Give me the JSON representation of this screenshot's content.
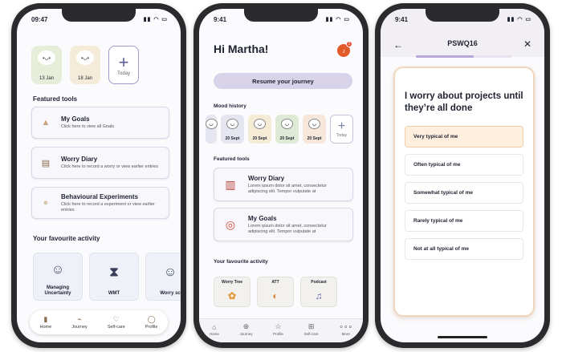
{
  "phone1": {
    "status": {
      "time": "09:47",
      "signal": "▮▮ ◠ ▭"
    },
    "moods": [
      {
        "date": "13 Jan",
        "color": "#e6edd9"
      },
      {
        "date": "18 Jan",
        "color": "#f4ecd8"
      }
    ],
    "today_label": "Today",
    "featured_title": "Featured tools",
    "tools": [
      {
        "title": "My Goals",
        "desc": "Click here to view all Goals",
        "icon": "mountain-icon",
        "glyph": "▲"
      },
      {
        "title": "Worry Diary",
        "desc": "Click here to record a worry or view earlier entries",
        "icon": "diary-icon",
        "glyph": "▤"
      },
      {
        "title": "Behavioural Experiments",
        "desc": "Click here to record a experiment or view earlier entries",
        "icon": "rock-icon",
        "glyph": "●"
      }
    ],
    "fav_title": "Your favourite activity",
    "activities": [
      {
        "label": "Managing Uncertainty",
        "glyph": "☺"
      },
      {
        "label": "WMT",
        "glyph": "⧗"
      },
      {
        "label": "Worry sc",
        "glyph": "☺"
      }
    ],
    "nav": [
      {
        "label": "Home",
        "icon": "home-icon",
        "glyph": "▮"
      },
      {
        "label": "Journey",
        "icon": "journey-icon",
        "glyph": "⌁"
      },
      {
        "label": "Self-care",
        "icon": "heart-icon",
        "glyph": "♡"
      },
      {
        "label": "Profile",
        "icon": "profile-icon",
        "glyph": "◯"
      }
    ]
  },
  "phone2": {
    "status": {
      "time": "9:41",
      "signal": "▮▮ ◠ ▭"
    },
    "greeting": "Hi Martha!",
    "notification_count": "2",
    "resume_label": "Resume your journey",
    "mood_title": "Mood history",
    "moods": [
      {
        "date": "20 Sept",
        "color": "#e5e6ef"
      },
      {
        "date": "20 Sept",
        "color": "#f6ecd6"
      },
      {
        "date": "20 Sept",
        "color": "#dfead6"
      },
      {
        "date": "20 Sept",
        "color": "#f6e7da"
      }
    ],
    "today_label": "Today",
    "featured_title": "Featured tools",
    "tools": [
      {
        "title": "Worry Diary",
        "desc": "Lorem ipsum dolor sit amet, consectetur adipiscing elit. Tempor vulputate at",
        "icon": "notebook-icon",
        "glyph": "▥"
      },
      {
        "title": "My Goals",
        "desc": "Lorem ipsum dolor sit amet, consectetur adipiscing elit. Tempor vulputate at",
        "icon": "target-icon",
        "glyph": "◎"
      }
    ],
    "fav_title": "Your favourite activity",
    "activities": [
      {
        "label": "Worry Tree",
        "glyph": "✿"
      },
      {
        "label": "ATT",
        "glyph": "◐"
      },
      {
        "label": "Podcast",
        "glyph": "♫"
      }
    ],
    "nav": [
      {
        "label": "Home",
        "icon": "home-icon",
        "glyph": "⌂"
      },
      {
        "label": "Journey",
        "icon": "journey-icon",
        "glyph": "⊕"
      },
      {
        "label": "Profile",
        "icon": "star-icon",
        "glyph": "☆"
      },
      {
        "label": "Self-care",
        "icon": "grid-icon",
        "glyph": "⊞"
      },
      {
        "label": "More",
        "icon": "more-icon",
        "glyph": "∘∘∘"
      }
    ]
  },
  "phone3": {
    "status": {
      "time": "9:41",
      "signal": "▮▮ ◠ ▭"
    },
    "title": "PSWQ16",
    "back_glyph": "←",
    "close_glyph": "✕",
    "progress": 0.6,
    "question": "I worry about projects until they’re all done",
    "options": [
      {
        "label": "Very typical of me",
        "selected": true
      },
      {
        "label": "Often typical of me",
        "selected": false
      },
      {
        "label": "Somewhat typical of me",
        "selected": false
      },
      {
        "label": "Rarely typical of me",
        "selected": false
      },
      {
        "label": "Not at all typical of me",
        "selected": false
      }
    ]
  }
}
